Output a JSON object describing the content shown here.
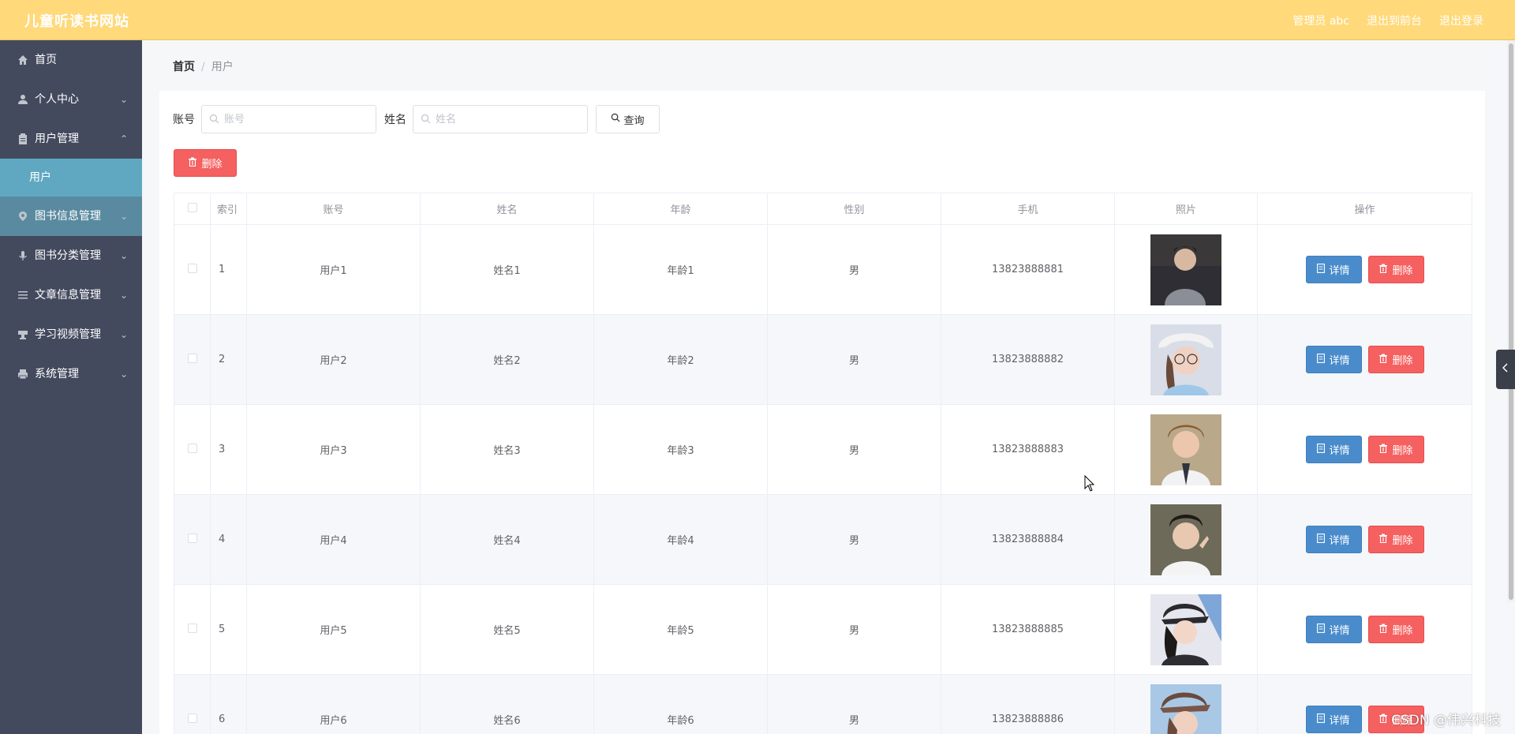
{
  "header": {
    "brand": "儿童听读书网站",
    "admin_label": "管理员 abc",
    "to_front": "退出到前台",
    "logout": "退出登录",
    "color": "#ffd97a"
  },
  "sidebar": {
    "items": [
      {
        "label": "首页",
        "icon": "home-icon"
      },
      {
        "label": "个人中心",
        "icon": "user-icon"
      },
      {
        "label": "用户管理",
        "icon": "clipboard-icon",
        "expanded": true,
        "children": [
          {
            "label": "用户"
          }
        ]
      },
      {
        "label": "图书信息管理",
        "icon": "location-icon"
      },
      {
        "label": "图书分类管理",
        "icon": "microphone-icon"
      },
      {
        "label": "文章信息管理",
        "icon": "list-icon"
      },
      {
        "label": "学习视频管理",
        "icon": "cup-icon"
      },
      {
        "label": "系统管理",
        "icon": "printer-icon"
      }
    ],
    "bg": "#434a5e",
    "active_bg": "#60a8c1"
  },
  "breadcrumb": {
    "home": "首页",
    "sep": "/",
    "current": "用户"
  },
  "search": {
    "account_label": "账号",
    "account_placeholder": "账号",
    "name_label": "姓名",
    "name_placeholder": "姓名",
    "query_button": "查询"
  },
  "batch_delete": "删除",
  "table": {
    "headers": [
      "索引",
      "账号",
      "姓名",
      "年龄",
      "性别",
      "手机",
      "照片",
      "操作"
    ],
    "rows": [
      {
        "index": "1",
        "account": "用户1",
        "name": "姓名1",
        "age": "年龄1",
        "gender": "男",
        "phone": "13823888881"
      },
      {
        "index": "2",
        "account": "用户2",
        "name": "姓名2",
        "age": "年龄2",
        "gender": "男",
        "phone": "13823888882"
      },
      {
        "index": "3",
        "account": "用户3",
        "name": "姓名3",
        "age": "年龄3",
        "gender": "男",
        "phone": "13823888883"
      },
      {
        "index": "4",
        "account": "用户4",
        "name": "姓名4",
        "age": "年龄4",
        "gender": "男",
        "phone": "13823888884"
      },
      {
        "index": "5",
        "account": "用户5",
        "name": "姓名5",
        "age": "年龄5",
        "gender": "男",
        "phone": "13823888885"
      },
      {
        "index": "6",
        "account": "用户6",
        "name": "姓名6",
        "age": "年龄6",
        "gender": "男",
        "phone": "13823888886"
      }
    ],
    "detail_button": "详情",
    "delete_button": "删除"
  },
  "watermark": "CSDN @伟兴科技"
}
